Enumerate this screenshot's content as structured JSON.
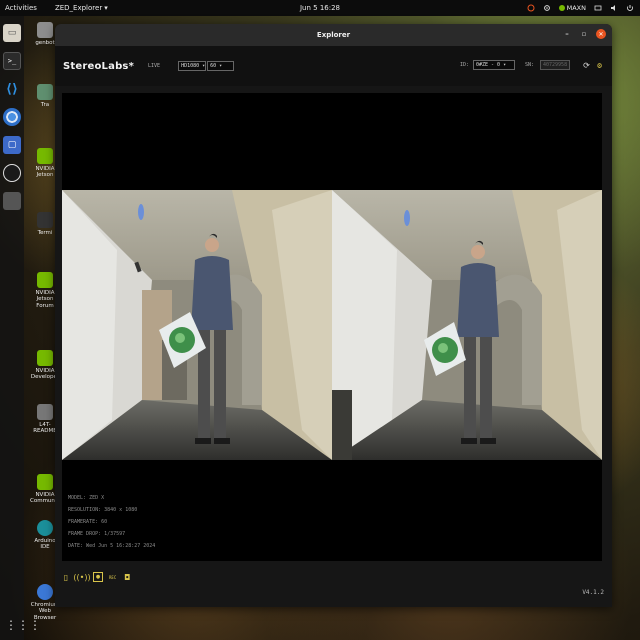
{
  "topbar": {
    "activities": "Activities",
    "app_name": "ZED_Explorer",
    "app_arrow": "▾",
    "clock": "Jun 5  16:28",
    "power_mode": "MAXN"
  },
  "desktop_icons": [
    {
      "label": "genbot"
    },
    {
      "label": "Tra"
    },
    {
      "label": "NVIDIA Jetson"
    },
    {
      "label": "Termi"
    },
    {
      "label": "NVIDIA Jetson Forum"
    },
    {
      "label": "NVIDIA Developer"
    },
    {
      "label": "L4T-README"
    },
    {
      "label": "NVIDIA Community"
    },
    {
      "label": "Arduino IDE"
    },
    {
      "label": "Chromium Web Browser"
    }
  ],
  "window": {
    "title": "Explorer",
    "brand": "StereoLabs*",
    "live_label": "LIVE",
    "resolution": "HD1080",
    "fps": "60",
    "id_label": "ID:",
    "id_value": "0#ZE - 0",
    "sn_label": "SN:",
    "sn_value": "40729958"
  },
  "stats": {
    "model": "MODEL: ZED X",
    "resolution": "RESOLUTION: 3840 x 1080",
    "framerate": "FRAMERATE: 60",
    "frame_drop": "FRAME DROP: 1/37597",
    "date": "DATE: Wed Jun 5 16:28:27 2024"
  },
  "bottombar": {
    "rec_label": "REC",
    "version": "V4.1.2"
  },
  "colors": {
    "accent": "#d8c44a",
    "close_button": "#e95420",
    "nvidia": "#76b900"
  }
}
